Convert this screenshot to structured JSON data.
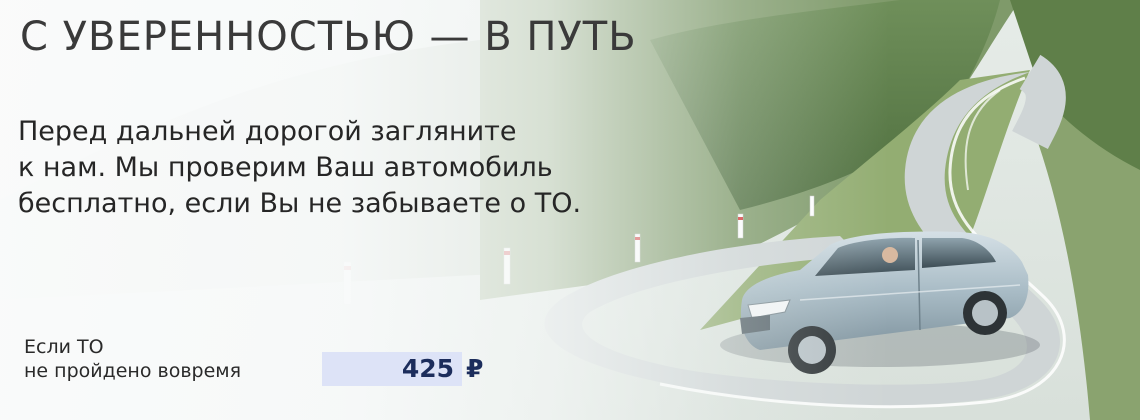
{
  "banner": {
    "headline": "С УВЕРЕННОСТЬЮ — В ПУТЬ",
    "body_lines": [
      "Перед дальней дорогой загляните",
      "к нам. Мы проверим Ваш автомобиль",
      "бесплатно, если Вы не забываете о ТО."
    ],
    "fine_label_lines": [
      "Если ТО",
      "не пройдено вовремя"
    ],
    "price": {
      "amount": "425",
      "currency_symbol": "₽"
    }
  },
  "colors": {
    "headline": "#3a3a3a",
    "price_box": "#dde3f7",
    "price_text": "#1c2d5c"
  },
  "image": {
    "subject": "car-on-mountain-road-illustration"
  }
}
